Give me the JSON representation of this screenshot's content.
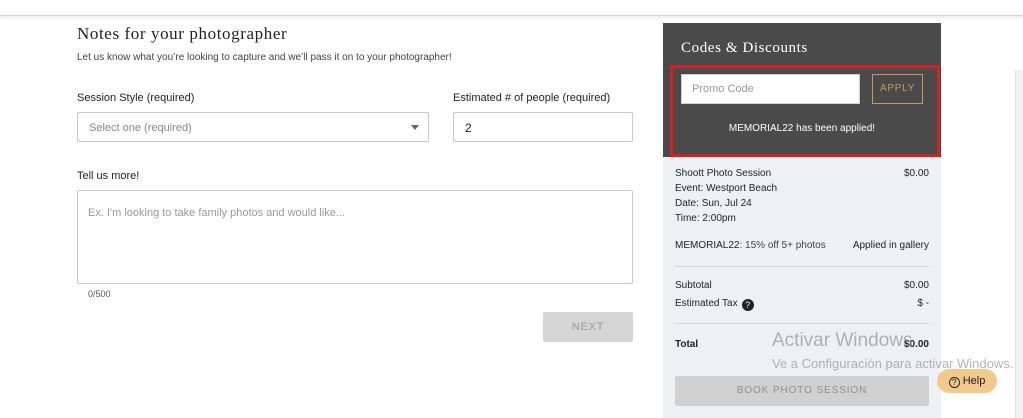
{
  "form": {
    "title": "Notes for your photographer",
    "subtitle": "Let us know what you’re looking to capture and we’ll pass it on to your photographer!",
    "session_style_label": "Session Style (required)",
    "session_style_placeholder": "Select one (required)",
    "people_label": "Estimated # of people (required)",
    "people_value": "2",
    "more_label": "Tell us more!",
    "more_placeholder": "Ex. I'm looking to take family photos and would like...",
    "char_counter": "0/500",
    "next_label": "NEXT"
  },
  "codes": {
    "title": "Codes & Discounts",
    "promo_placeholder": "Promo Code",
    "apply_label": "APPLY",
    "applied_message": "MEMORIAL22 has been applied!"
  },
  "summary": {
    "session_name": "Shoott Photo Session",
    "session_price": "$0.00",
    "event_label": "Event:",
    "event_value": "Westport Beach",
    "date_label": "Date:",
    "date_value": "Sun, Jul 24",
    "time_label": "Time:",
    "time_value": "2:00pm",
    "discount_code": "MEMORIAL22",
    "discount_desc": ": 15% off 5+ photos",
    "discount_status": "Applied in gallery",
    "subtotal_label": "Subtotal",
    "subtotal_value": "$0.00",
    "tax_label": "Estimated Tax",
    "tax_value": "$ -",
    "total_label": "Total",
    "total_value": "$0.00",
    "book_label": "BOOK PHOTO SESSION"
  },
  "watermark": {
    "line1": "Activar Windows",
    "line2": "Ve a Configuración para activar Windows."
  },
  "help": {
    "label": "Help",
    "icon": "question-circle-icon"
  },
  "colors": {
    "accent_gold": "#c59a5a",
    "dark_panel": "#4a4a4a",
    "highlight_red": "#d81e1e",
    "help_button": "#f2c98a"
  }
}
